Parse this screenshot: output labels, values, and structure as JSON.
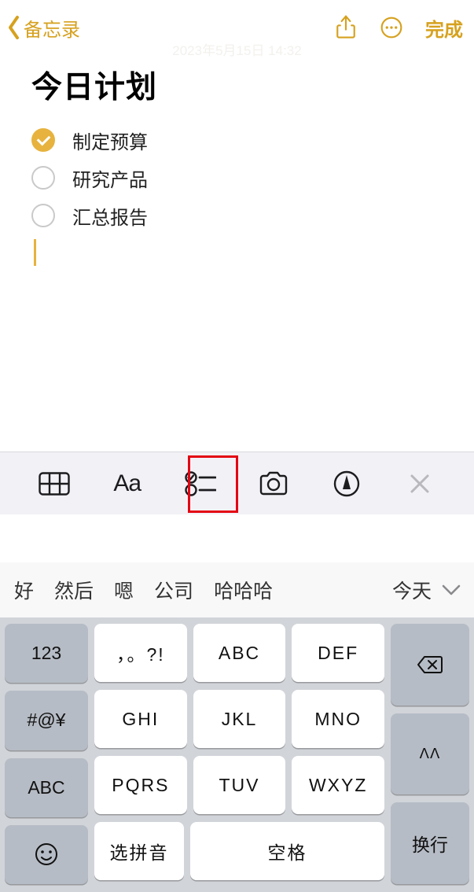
{
  "nav": {
    "back_label": "备忘录",
    "done_label": "完成"
  },
  "timestamp": "2023年5月15日 14:32",
  "note": {
    "title": "今日计划",
    "items": [
      {
        "text": "制定预算",
        "done": true
      },
      {
        "text": "研究产品",
        "done": false
      },
      {
        "text": "汇总报告",
        "done": false
      }
    ]
  },
  "toolbar": {
    "aa_label": "Aa"
  },
  "suggestions": [
    "好",
    "然后",
    "嗯",
    "公司",
    "哈哈哈",
    "今天"
  ],
  "keyboard": {
    "side": [
      "123",
      "#@¥",
      "ABC"
    ],
    "grid": [
      [
        "，。?!",
        "ABC",
        "DEF"
      ],
      [
        "GHI",
        "JKL",
        "MNO"
      ],
      [
        "PQRS",
        "TUV",
        "WXYZ"
      ]
    ],
    "bottom_left": "选拼音",
    "bottom_right": "空格",
    "caret": "ᐱᐱ",
    "return": "换行"
  }
}
